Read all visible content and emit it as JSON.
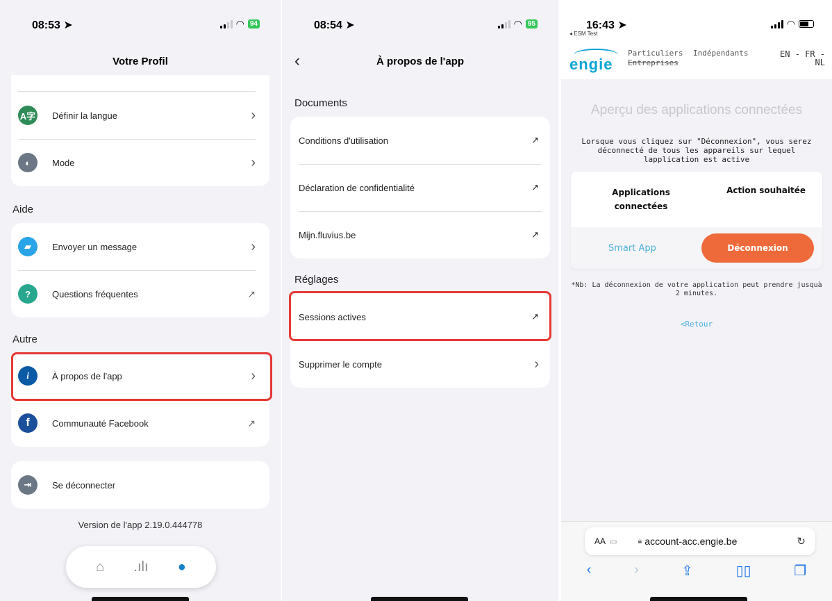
{
  "screen1": {
    "status": {
      "time": "08:53 ➤",
      "battery": "94"
    },
    "title": "Votre Profil",
    "settings_items": [
      {
        "label": "Définir la langue",
        "icon": "translate-icon",
        "color": "#2e8b57"
      },
      {
        "label": "Mode",
        "icon": "contrast-icon",
        "color": "#6b7785"
      }
    ],
    "help_title": "Aide",
    "help_items": [
      {
        "label": "Envoyer un message",
        "icon": "chat-icon",
        "color": "#2aa4e8"
      },
      {
        "label": "Questions fréquentes",
        "icon": "question-icon",
        "color": "#27a88e"
      }
    ],
    "other_title": "Autre",
    "other_items": [
      {
        "label": "À propos de l'app",
        "icon": "info-icon",
        "color": "#0b5aa6"
      },
      {
        "label": "Communauté Facebook",
        "icon": "facebook-icon",
        "color": "#1b4f9c"
      }
    ],
    "logout_label": "Se déconnecter",
    "version": "Version de l'app 2.19.0.444778",
    "tabs": [
      {
        "name": "home",
        "glyph": "🏠"
      },
      {
        "name": "stats",
        "glyph": ".ılı"
      },
      {
        "name": "profile",
        "glyph": "👤"
      }
    ]
  },
  "screen2": {
    "status": {
      "time": "08:54 ➤",
      "battery": "95"
    },
    "title": "À propos de l'app",
    "documents_title": "Documents",
    "documents": [
      "Conditions d'utilisation",
      "Déclaration de confidentialité",
      "Mijn.fluvius.be"
    ],
    "settings_title": "Réglages",
    "settings": [
      "Sessions actives",
      "Supprimer le compte"
    ]
  },
  "screen3": {
    "status": {
      "time": "16:43 ➤",
      "carrier": "◂ ESM Test"
    },
    "logo": "engie",
    "nav": {
      "particuliers": "Particuliers",
      "entreprises": "Entreprises",
      "independants": "Indépendants"
    },
    "lang": {
      "line1": "EN - FR -",
      "line2": "NL"
    },
    "heading": "Aperçu des applications connectées",
    "description": "Lorsque vous cliquez sur \"Déconnexion\", vous serez déconnecté de tous les appareils sur lequel lapplication est active",
    "table": {
      "col1": "Applications connectées",
      "col2": "Action souhaitée",
      "app_name": "Smart App",
      "action_label": "Déconnexion"
    },
    "note": "*Nb: La déconnexion de votre application peut prendre jusquà 2 minutes.",
    "back_link": "<Retour",
    "url_aa": "AA",
    "url": "account-acc.engie.be"
  },
  "colors": {
    "highlight": "#e53935",
    "engie_blue": "#0aa4d4",
    "logout_orange": "#ee6a3a",
    "tab_active": "#1582c8"
  }
}
